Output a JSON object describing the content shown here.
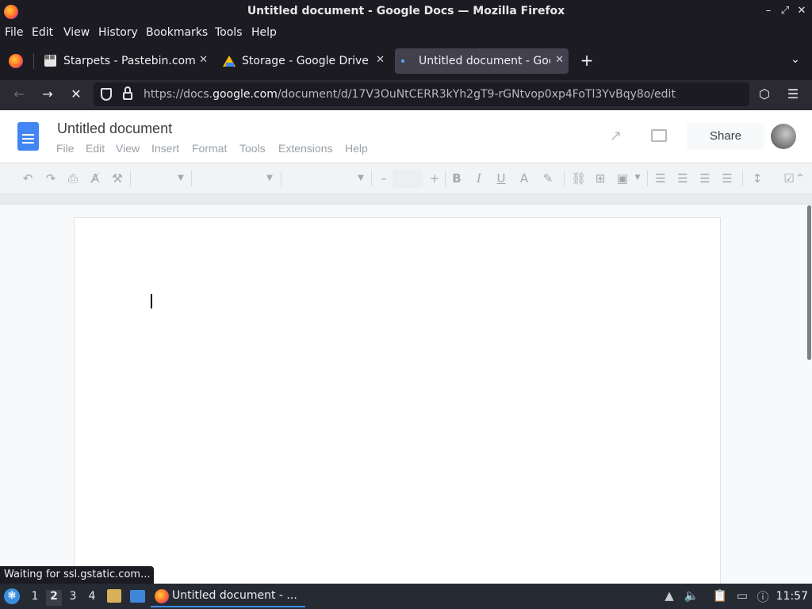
{
  "window": {
    "title": "Untitled document - Google Docs — Mozilla Firefox",
    "controls": [
      "minimize",
      "maximize",
      "close"
    ]
  },
  "menubar": {
    "items": [
      "File",
      "Edit",
      "View",
      "History",
      "Bookmarks",
      "Tools",
      "Help"
    ]
  },
  "tabs": [
    {
      "label": "Starpets - Pastebin.com",
      "icon": "pastebin-icon"
    },
    {
      "label": "Storage - Google Drive",
      "icon": "google-drive-icon"
    },
    {
      "label": "Untitled document - Goo",
      "icon": "loading-dot-icon",
      "active": true
    }
  ],
  "navbar": {
    "url_prefix": "https://docs.",
    "url_domain": "google.com",
    "url_rest": "/document/d/17V3OuNtCERR3kYh2gT9-rGNtvop0xp4FoTl3YvBqy8o/edit"
  },
  "docs": {
    "title": "Untitled document",
    "menu": [
      "File",
      "Edit",
      "View",
      "Insert",
      "Format",
      "Tools",
      "Extensions",
      "Help"
    ],
    "share_label": "Share"
  },
  "status_popup": "Waiting for ssl.gstatic.com...",
  "taskbar": {
    "workspaces": [
      "1",
      "2",
      "3",
      "4"
    ],
    "active_workspace": "2",
    "task_label": "Untitled document - ...",
    "clock": "11:57"
  },
  "colors": {
    "accent": "#3d8ee8",
    "docs_blue": "#4285f4"
  }
}
